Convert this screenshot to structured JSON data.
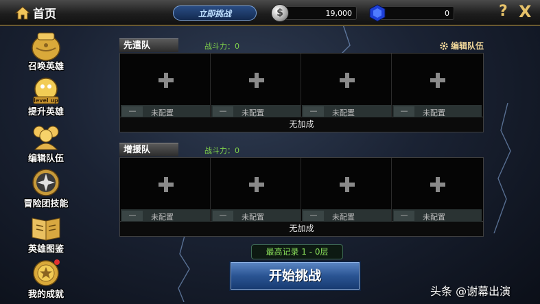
{
  "topbar": {
    "home_label": "首页",
    "challenge_button": "立即挑战",
    "silver_amount": "19,000",
    "gem_amount": "0",
    "help_label": "?",
    "close_label": "X"
  },
  "sidebar": {
    "items": [
      {
        "label": "召唤英雄",
        "icon": "summon-urn-icon"
      },
      {
        "label": "提升英雄",
        "icon": "level-up-icon",
        "icon_text": "level up"
      },
      {
        "label": "编辑队伍",
        "icon": "team-icon"
      },
      {
        "label": "冒险团技能",
        "icon": "shuriken-icon"
      },
      {
        "label": "英雄图鉴",
        "icon": "book-icon"
      },
      {
        "label": "我的成就",
        "icon": "medal-icon"
      }
    ]
  },
  "vanguard": {
    "title": "先遣队",
    "power": "战斗力：0",
    "edit_label": "编辑队伍",
    "slots": [
      {
        "minus": "—",
        "status": "未配置"
      },
      {
        "minus": "—",
        "status": "未配置"
      },
      {
        "minus": "—",
        "status": "未配置"
      },
      {
        "minus": "—",
        "status": "未配置"
      }
    ],
    "bonus": "无加成"
  },
  "reinforce": {
    "title": "增援队",
    "power": "战斗力：0",
    "slots": [
      {
        "minus": "—",
        "status": "未配置"
      },
      {
        "minus": "—",
        "status": "未配置"
      },
      {
        "minus": "—",
        "status": "未配置"
      },
      {
        "minus": "—",
        "status": "未配置"
      }
    ],
    "bonus": "无加成"
  },
  "record": "最高记录 1 - 0层",
  "start_button": "开始挑战",
  "watermark": "头条 @谢幕出演",
  "colors": {
    "accent_gold": "#e6c26a",
    "power_green": "#7fd24b",
    "button_blue": "#2a5493"
  }
}
